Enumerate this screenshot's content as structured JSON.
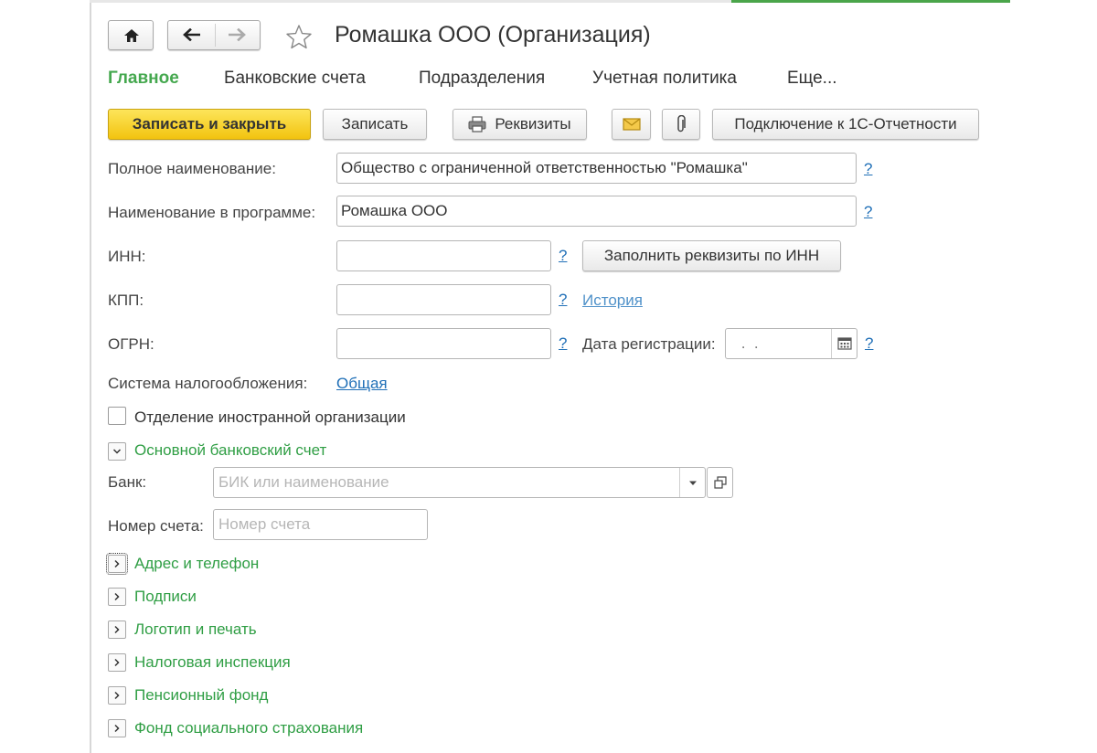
{
  "window": {
    "title": "Ромашка ООО (Организация)"
  },
  "nav": {
    "home_icon": "home-icon",
    "back_icon": "arrow-left-icon",
    "forward_icon": "arrow-right-icon",
    "favorite_icon": "star-outline-icon"
  },
  "tabs": [
    {
      "label": "Главное",
      "active": true
    },
    {
      "label": "Банковские счета"
    },
    {
      "label": "Подразделения"
    },
    {
      "label": "Учетная политика"
    },
    {
      "label": "Еще..."
    }
  ],
  "toolbar": {
    "save_close": "Записать и закрыть",
    "save": "Записать",
    "requisites": "Реквизиты",
    "connect_reporting": "Подключение к 1С-Отчетности",
    "mail_icon": "envelope-icon",
    "attach_icon": "paperclip-icon",
    "print_icon": "printer-icon"
  },
  "form": {
    "full_name": {
      "label": "Полное наименование:",
      "value": "Общество с ограниченной ответственностью \"Ромашка\""
    },
    "short_name": {
      "label": "Наименование в программе:",
      "value": "Ромашка ООО"
    },
    "inn": {
      "label": "ИНН:",
      "value": "",
      "fill_button": "Заполнить реквизиты по ИНН"
    },
    "kpp": {
      "label": "КПП:",
      "value": "",
      "history_link": "История"
    },
    "ogrn": {
      "label": "ОГРН:",
      "value": ""
    },
    "reg_date": {
      "label": "Дата регистрации:",
      "value": " .  ."
    },
    "tax_system": {
      "label": "Система налогообложения:",
      "value": "Общая"
    },
    "foreign_branch": {
      "label": "Отделение иностранной организации",
      "checked": false
    },
    "help_mark": "?"
  },
  "bank_group": {
    "title": "Основной банковский счет",
    "bank_label": "Банк:",
    "bank_placeholder": "БИК или наименование",
    "account_label": "Номер счета:",
    "account_placeholder": "Номер счета"
  },
  "collapsed_groups": [
    "Адрес и телефон",
    "Подписи",
    "Логотип и печать",
    "Налоговая инспекция",
    "Пенсионный фонд",
    "Фонд социального страхования"
  ],
  "colors": {
    "accent_green": "#45a84f",
    "group_green": "#2f9e44",
    "link_blue": "#1f6fb7",
    "primary_yellow": "#f5cb1c"
  }
}
